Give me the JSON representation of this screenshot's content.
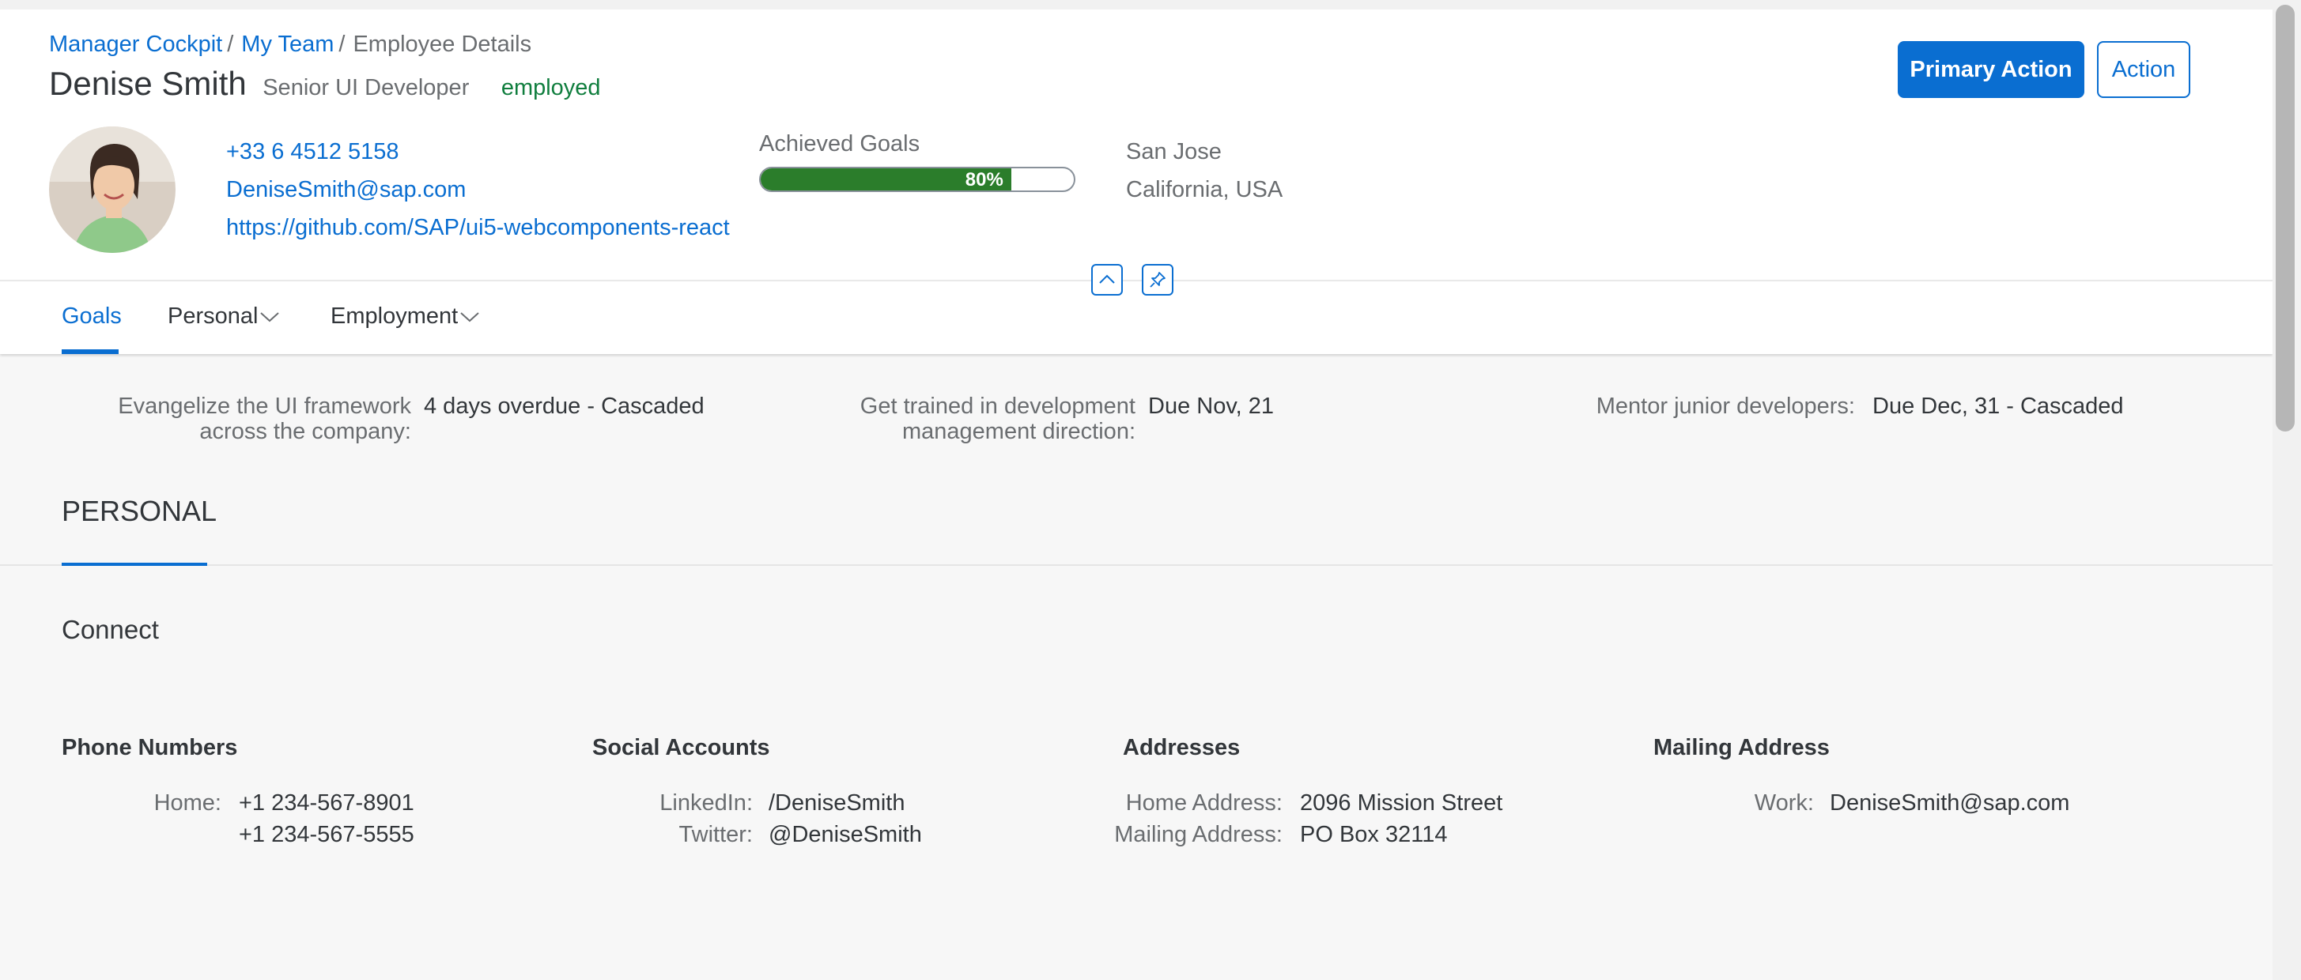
{
  "breadcrumb": {
    "items": [
      "Manager Cockpit",
      "My Team"
    ],
    "separator": "/",
    "current": "Employee Details"
  },
  "header": {
    "title": "Denise Smith",
    "subtitle": "Senior UI Developer",
    "status": "employed",
    "status_color": "#107e3e",
    "avatar_icon": "person-photo",
    "links": {
      "phone": "+33 6 4512 5158",
      "email": "DeniseSmith@sap.com",
      "url": "https://github.com/SAP/ui5-webcomponents-react"
    },
    "achieved_goals": {
      "label": "Achieved Goals",
      "value": 80,
      "display": "80%"
    },
    "location": {
      "city": "San Jose",
      "region": "California, USA"
    },
    "collapse_icon": "chevron-up-icon",
    "pin_icon": "pin-icon"
  },
  "actions": {
    "primary": "Primary Action",
    "secondary": "Action"
  },
  "tabs": [
    {
      "label": "Goals",
      "active": true
    },
    {
      "label": "Personal",
      "active": false,
      "has_menu": true
    },
    {
      "label": "Employment",
      "active": false,
      "has_menu": true
    }
  ],
  "goals": [
    {
      "label": "Evangelize the UI framework across the company:",
      "value": "4 days overdue - Cascaded"
    },
    {
      "label": "Get trained in development management direction:",
      "value": "Due Nov, 21"
    },
    {
      "label": "Mentor junior developers:",
      "value": "Due Dec, 31 - Cascaded"
    }
  ],
  "personal": {
    "title": "PERSONAL",
    "subsection": "Connect",
    "phone_numbers": {
      "title": "Phone Numbers",
      "label": "Home:",
      "values": [
        "+1 234-567-8901",
        "+1 234-567-5555"
      ]
    },
    "social_accounts": {
      "title": "Social Accounts",
      "linkedin_label": "LinkedIn:",
      "linkedin_value": "/DeniseSmith",
      "twitter_label": "Twitter:",
      "twitter_value": "@DeniseSmith"
    },
    "addresses": {
      "title": "Addresses",
      "home_label": "Home Address:",
      "home_value": "2096 Mission Street",
      "mailing_label": "Mailing Address:",
      "mailing_value": "PO Box 32114"
    },
    "mailing_address": {
      "title": "Mailing Address",
      "work_label": "Work:",
      "work_value": "DeniseSmith@sap.com"
    }
  },
  "colors": {
    "brand": "#0a6ed1",
    "positive": "#2b7d2b",
    "text": "#32363a",
    "label": "#6a6d70"
  }
}
